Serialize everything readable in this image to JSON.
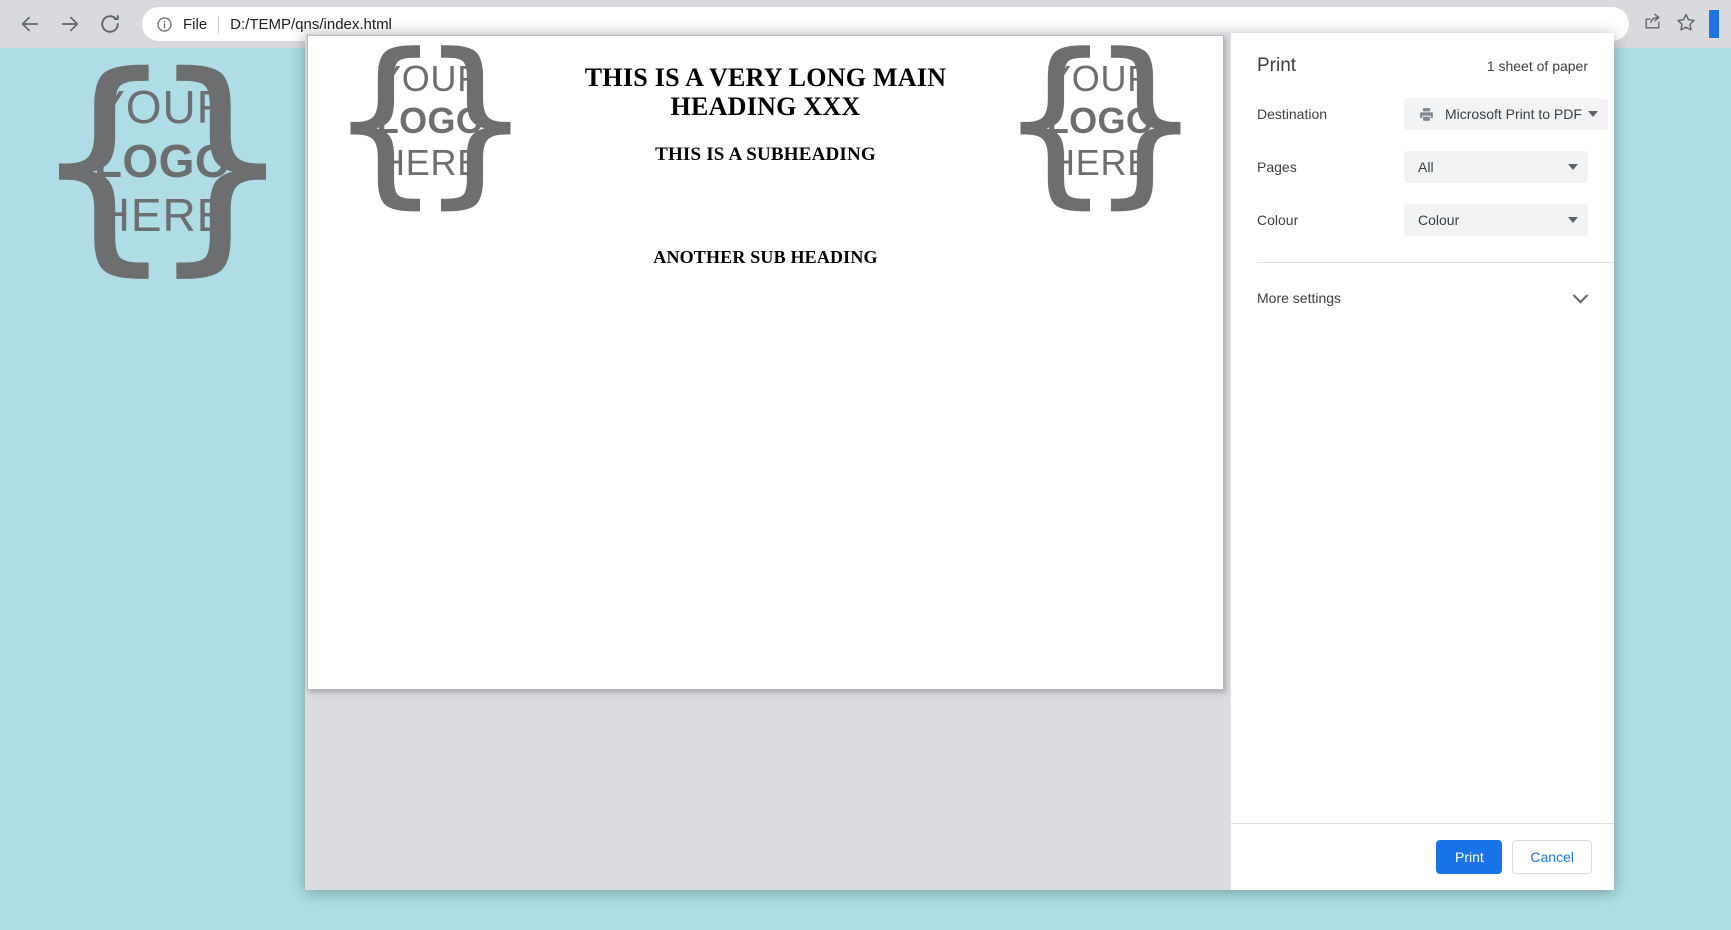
{
  "browser": {
    "back_icon": "arrow-left-icon",
    "forward_icon": "arrow-right-icon",
    "reload_icon": "reload-icon",
    "info_icon": "info-circle-icon",
    "scheme_label": "File",
    "url": "D:/TEMP/qns/index.html",
    "share_icon": "share-icon",
    "bookmark_icon": "star-icon"
  },
  "page": {
    "background_color": "#aedde5",
    "logo": {
      "line1": "YOUR",
      "line2": "LOGO",
      "line3": "HERE",
      "brace_left": "{",
      "brace_right": "}",
      "color": "#6d6e70"
    }
  },
  "print_dialog": {
    "title": "Print",
    "sheet_count": "1 sheet of paper",
    "settings": [
      {
        "label": "Destination",
        "value": "Microsoft Print to PDF",
        "icon": "printer-icon"
      },
      {
        "label": "Pages",
        "value": "All",
        "icon": ""
      },
      {
        "label": "Colour",
        "value": "Colour",
        "icon": ""
      }
    ],
    "more_settings_label": "More settings",
    "more_settings_icon": "chevron-down-icon",
    "print_button": "Print",
    "cancel_button": "Cancel",
    "accent_color": "#1a73e8"
  },
  "preview": {
    "logo": {
      "line1": "YOUR",
      "line2": "LOGO",
      "line3": "HERE",
      "brace_left": "{",
      "brace_right": "}"
    },
    "main_heading": "THIS IS A VERY LONG MAIN HEADING XXX",
    "sub_heading": "THIS IS A SUBHEADING",
    "another_sub_heading": "ANOTHER SUB HEADING"
  }
}
